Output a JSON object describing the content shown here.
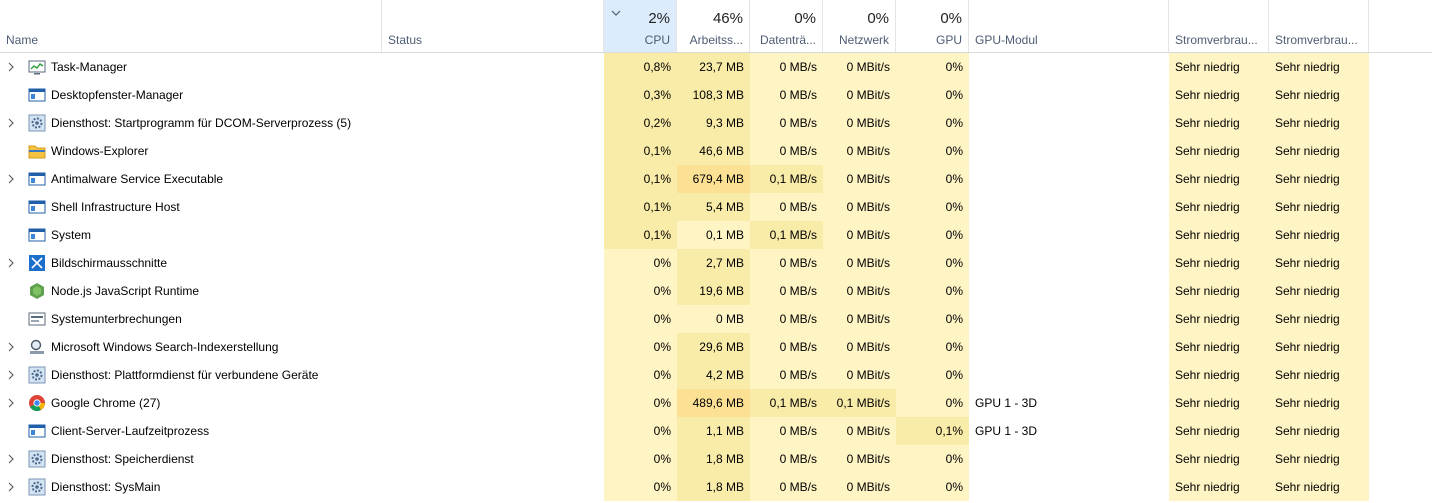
{
  "header": {
    "name": "Name",
    "status": "Status",
    "cpu": {
      "pct": "2%",
      "label": "CPU"
    },
    "memory": {
      "pct": "46%",
      "label": "Arbeitss..."
    },
    "disk": {
      "pct": "0%",
      "label": "Datenträ..."
    },
    "network": {
      "pct": "0%",
      "label": "Netzwerk"
    },
    "gpu": {
      "pct": "0%",
      "label": "GPU"
    },
    "gpu_engine": "GPU-Modul",
    "power": "Stromverbrau...",
    "power_trend": "Stromverbrau..."
  },
  "processes": [
    {
      "name": "Task-Manager",
      "icon": "task-manager-icon",
      "expand": true,
      "cpu": "0,8%",
      "mem": "23,7 MB",
      "disk": "0 MB/s",
      "net": "0 MBit/s",
      "gpu": "0%",
      "engine": "",
      "power": "Sehr niedrig",
      "trend": "Sehr niedrig"
    },
    {
      "name": "Desktopfenster-Manager",
      "icon": "window-app-icon",
      "expand": false,
      "cpu": "0,3%",
      "mem": "108,3 MB",
      "disk": "0 MB/s",
      "net": "0 MBit/s",
      "gpu": "0%",
      "engine": "",
      "power": "Sehr niedrig",
      "trend": "Sehr niedrig"
    },
    {
      "name": "Diensthost: Startprogramm für DCOM-Serverprozess (5)",
      "icon": "service-gear-icon",
      "expand": true,
      "cpu": "0,2%",
      "mem": "9,3 MB",
      "disk": "0 MB/s",
      "net": "0 MBit/s",
      "gpu": "0%",
      "engine": "",
      "power": "Sehr niedrig",
      "trend": "Sehr niedrig"
    },
    {
      "name": "Windows-Explorer",
      "icon": "folder-icon",
      "expand": false,
      "cpu": "0,1%",
      "mem": "46,6 MB",
      "disk": "0 MB/s",
      "net": "0 MBit/s",
      "gpu": "0%",
      "engine": "",
      "power": "Sehr niedrig",
      "trend": "Sehr niedrig"
    },
    {
      "name": "Antimalware Service Executable",
      "icon": "window-app-icon",
      "expand": true,
      "cpu": "0,1%",
      "mem": "679,4 MB",
      "disk": "0,1 MB/s",
      "net": "0 MBit/s",
      "gpu": "0%",
      "engine": "",
      "power": "Sehr niedrig",
      "trend": "Sehr niedrig"
    },
    {
      "name": "Shell Infrastructure Host",
      "icon": "window-app-icon",
      "expand": false,
      "cpu": "0,1%",
      "mem": "5,4 MB",
      "disk": "0 MB/s",
      "net": "0 MBit/s",
      "gpu": "0%",
      "engine": "",
      "power": "Sehr niedrig",
      "trend": "Sehr niedrig"
    },
    {
      "name": "System",
      "icon": "window-app-icon",
      "expand": false,
      "cpu": "0,1%",
      "mem": "0,1 MB",
      "disk": "0,1 MB/s",
      "net": "0 MBit/s",
      "gpu": "0%",
      "engine": "",
      "power": "Sehr niedrig",
      "trend": "Sehr niedrig"
    },
    {
      "name": "Bildschirmausschnitte",
      "icon": "snipping-icon",
      "expand": true,
      "cpu": "0%",
      "mem": "2,7 MB",
      "disk": "0 MB/s",
      "net": "0 MBit/s",
      "gpu": "0%",
      "engine": "",
      "power": "Sehr niedrig",
      "trend": "Sehr niedrig"
    },
    {
      "name": "Node.js JavaScript Runtime",
      "icon": "nodejs-icon",
      "expand": false,
      "cpu": "0%",
      "mem": "19,6 MB",
      "disk": "0 MB/s",
      "net": "0 MBit/s",
      "gpu": "0%",
      "engine": "",
      "power": "Sehr niedrig",
      "trend": "Sehr niedrig"
    },
    {
      "name": "Systemunterbrechungen",
      "icon": "system-interrupts-icon",
      "expand": false,
      "cpu": "0%",
      "mem": "0 MB",
      "disk": "0 MB/s",
      "net": "0 MBit/s",
      "gpu": "0%",
      "engine": "",
      "power": "Sehr niedrig",
      "trend": "Sehr niedrig"
    },
    {
      "name": "Microsoft Windows Search-Indexerstellung",
      "icon": "search-indexer-icon",
      "expand": true,
      "cpu": "0%",
      "mem": "29,6 MB",
      "disk": "0 MB/s",
      "net": "0 MBit/s",
      "gpu": "0%",
      "engine": "",
      "power": "Sehr niedrig",
      "trend": "Sehr niedrig"
    },
    {
      "name": "Diensthost: Plattformdienst für verbundene Geräte",
      "icon": "service-gear-icon",
      "expand": true,
      "cpu": "0%",
      "mem": "4,2 MB",
      "disk": "0 MB/s",
      "net": "0 MBit/s",
      "gpu": "0%",
      "engine": "",
      "power": "Sehr niedrig",
      "trend": "Sehr niedrig"
    },
    {
      "name": "Google Chrome (27)",
      "icon": "chrome-icon",
      "expand": true,
      "cpu": "0%",
      "mem": "489,6 MB",
      "disk": "0,1 MB/s",
      "net": "0,1 MBit/s",
      "gpu": "0%",
      "engine": "GPU 1 - 3D",
      "power": "Sehr niedrig",
      "trend": "Sehr niedrig"
    },
    {
      "name": "Client-Server-Laufzeitprozess",
      "icon": "window-app-icon",
      "expand": false,
      "cpu": "0%",
      "mem": "1,1 MB",
      "disk": "0 MB/s",
      "net": "0 MBit/s",
      "gpu": "0,1%",
      "engine": "GPU 1 - 3D",
      "power": "Sehr niedrig",
      "trend": "Sehr niedrig"
    },
    {
      "name": "Diensthost: Speicherdienst",
      "icon": "service-gear-icon",
      "expand": true,
      "cpu": "0%",
      "mem": "1,8 MB",
      "disk": "0 MB/s",
      "net": "0 MBit/s",
      "gpu": "0%",
      "engine": "",
      "power": "Sehr niedrig",
      "trend": "Sehr niedrig"
    },
    {
      "name": "Diensthost: SysMain",
      "icon": "service-gear-icon",
      "expand": true,
      "cpu": "0%",
      "mem": "1,8 MB",
      "disk": "0 MB/s",
      "net": "0 MBit/s",
      "gpu": "0%",
      "engine": "",
      "power": "Sehr niedrig",
      "trend": "Sehr niedrig"
    }
  ]
}
